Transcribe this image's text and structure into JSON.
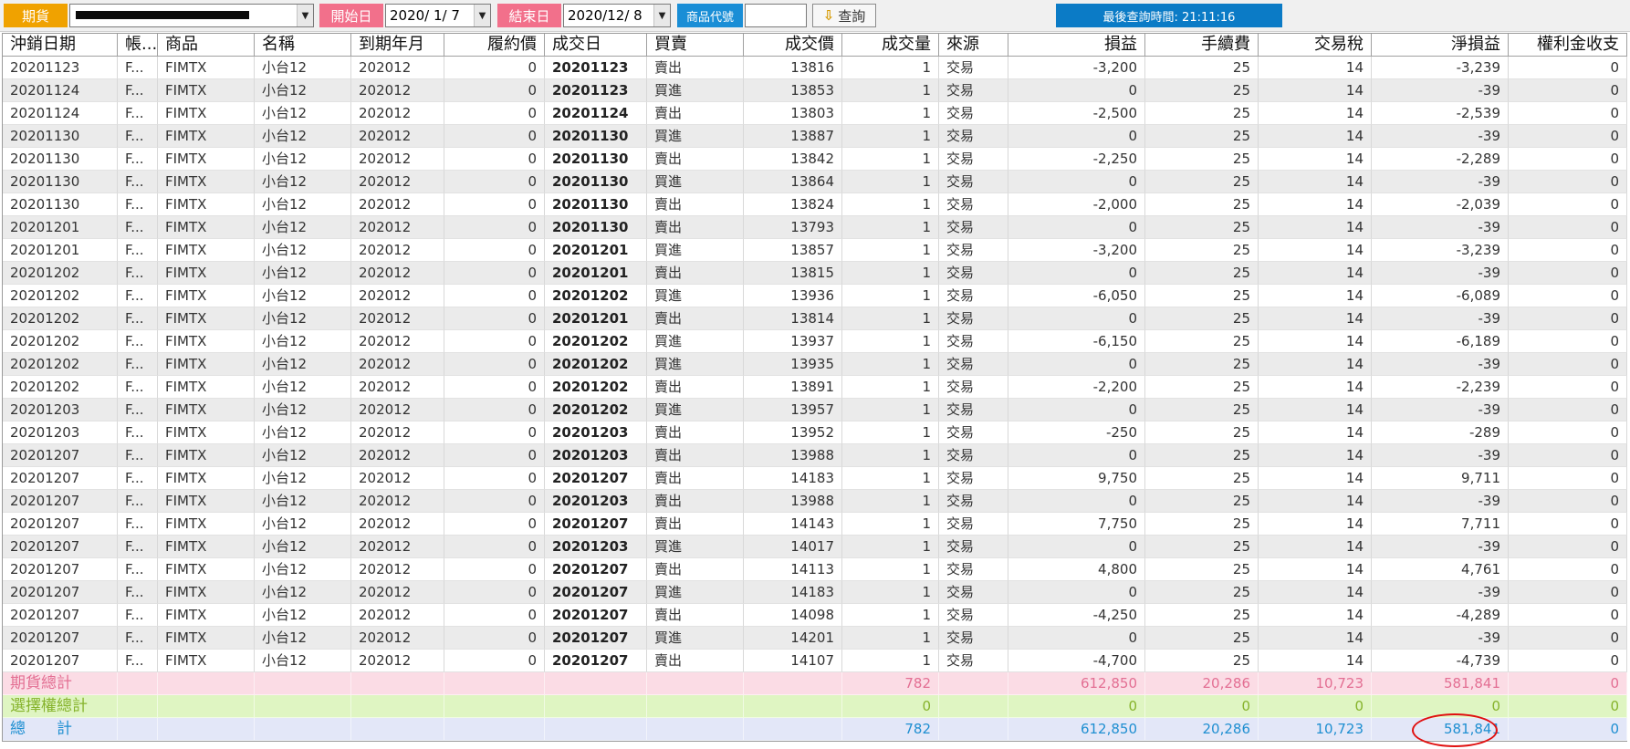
{
  "toolbar": {
    "futures_label": "期貨",
    "account_masked": "",
    "start_label": "開始日",
    "start_date": "2020/ 1/ 7",
    "end_label": "結束日",
    "end_date": "2020/12/ 8",
    "product_code_label": "商品代號",
    "product_code_value": "",
    "query_label": "查詢",
    "last_query_text": "最後查詢時間: 21:11:16"
  },
  "colors": {
    "label_orange": "#f0a200",
    "label_pink": "#f2708b",
    "label_blue": "#1a8ed6",
    "sum_futures_bg": "#fbdce5",
    "sum_options_bg": "#dff5c2",
    "sum_total_bg": "#e3e7f8",
    "highlight": "#e01010"
  },
  "icons": {
    "dropdown": "chevron-down-icon",
    "query": "down-arrow-icon"
  },
  "table": {
    "headers": [
      "沖銷日期",
      "帳...",
      "商品",
      "名稱",
      "到期年月",
      "履約價",
      "成交日",
      "買賣",
      "成交價",
      "成交量",
      "來源",
      "損益",
      "手續費",
      "交易稅",
      "淨損益",
      "權利金收支"
    ],
    "rows": [
      [
        "20201123",
        "F...",
        "FIMTX",
        "小台12",
        "202012",
        "0",
        "20201123",
        "賣出",
        "13816",
        "1",
        "交易",
        "-3,200",
        "25",
        "14",
        "-3,239",
        "0"
      ],
      [
        "20201124",
        "F...",
        "FIMTX",
        "小台12",
        "202012",
        "0",
        "20201123",
        "買進",
        "13853",
        "1",
        "交易",
        "0",
        "25",
        "14",
        "-39",
        "0"
      ],
      [
        "20201124",
        "F...",
        "FIMTX",
        "小台12",
        "202012",
        "0",
        "20201124",
        "賣出",
        "13803",
        "1",
        "交易",
        "-2,500",
        "25",
        "14",
        "-2,539",
        "0"
      ],
      [
        "20201130",
        "F...",
        "FIMTX",
        "小台12",
        "202012",
        "0",
        "20201130",
        "買進",
        "13887",
        "1",
        "交易",
        "0",
        "25",
        "14",
        "-39",
        "0"
      ],
      [
        "20201130",
        "F...",
        "FIMTX",
        "小台12",
        "202012",
        "0",
        "20201130",
        "賣出",
        "13842",
        "1",
        "交易",
        "-2,250",
        "25",
        "14",
        "-2,289",
        "0"
      ],
      [
        "20201130",
        "F...",
        "FIMTX",
        "小台12",
        "202012",
        "0",
        "20201130",
        "買進",
        "13864",
        "1",
        "交易",
        "0",
        "25",
        "14",
        "-39",
        "0"
      ],
      [
        "20201130",
        "F...",
        "FIMTX",
        "小台12",
        "202012",
        "0",
        "20201130",
        "賣出",
        "13824",
        "1",
        "交易",
        "-2,000",
        "25",
        "14",
        "-2,039",
        "0"
      ],
      [
        "20201201",
        "F...",
        "FIMTX",
        "小台12",
        "202012",
        "0",
        "20201130",
        "賣出",
        "13793",
        "1",
        "交易",
        "0",
        "25",
        "14",
        "-39",
        "0"
      ],
      [
        "20201201",
        "F...",
        "FIMTX",
        "小台12",
        "202012",
        "0",
        "20201201",
        "買進",
        "13857",
        "1",
        "交易",
        "-3,200",
        "25",
        "14",
        "-3,239",
        "0"
      ],
      [
        "20201202",
        "F...",
        "FIMTX",
        "小台12",
        "202012",
        "0",
        "20201201",
        "賣出",
        "13815",
        "1",
        "交易",
        "0",
        "25",
        "14",
        "-39",
        "0"
      ],
      [
        "20201202",
        "F...",
        "FIMTX",
        "小台12",
        "202012",
        "0",
        "20201202",
        "買進",
        "13936",
        "1",
        "交易",
        "-6,050",
        "25",
        "14",
        "-6,089",
        "0"
      ],
      [
        "20201202",
        "F...",
        "FIMTX",
        "小台12",
        "202012",
        "0",
        "20201201",
        "賣出",
        "13814",
        "1",
        "交易",
        "0",
        "25",
        "14",
        "-39",
        "0"
      ],
      [
        "20201202",
        "F...",
        "FIMTX",
        "小台12",
        "202012",
        "0",
        "20201202",
        "買進",
        "13937",
        "1",
        "交易",
        "-6,150",
        "25",
        "14",
        "-6,189",
        "0"
      ],
      [
        "20201202",
        "F...",
        "FIMTX",
        "小台12",
        "202012",
        "0",
        "20201202",
        "買進",
        "13935",
        "1",
        "交易",
        "0",
        "25",
        "14",
        "-39",
        "0"
      ],
      [
        "20201202",
        "F...",
        "FIMTX",
        "小台12",
        "202012",
        "0",
        "20201202",
        "賣出",
        "13891",
        "1",
        "交易",
        "-2,200",
        "25",
        "14",
        "-2,239",
        "0"
      ],
      [
        "20201203",
        "F...",
        "FIMTX",
        "小台12",
        "202012",
        "0",
        "20201202",
        "買進",
        "13957",
        "1",
        "交易",
        "0",
        "25",
        "14",
        "-39",
        "0"
      ],
      [
        "20201203",
        "F...",
        "FIMTX",
        "小台12",
        "202012",
        "0",
        "20201203",
        "賣出",
        "13952",
        "1",
        "交易",
        "-250",
        "25",
        "14",
        "-289",
        "0"
      ],
      [
        "20201207",
        "F...",
        "FIMTX",
        "小台12",
        "202012",
        "0",
        "20201203",
        "賣出",
        "13988",
        "1",
        "交易",
        "0",
        "25",
        "14",
        "-39",
        "0"
      ],
      [
        "20201207",
        "F...",
        "FIMTX",
        "小台12",
        "202012",
        "0",
        "20201207",
        "賣出",
        "14183",
        "1",
        "交易",
        "9,750",
        "25",
        "14",
        "9,711",
        "0"
      ],
      [
        "20201207",
        "F...",
        "FIMTX",
        "小台12",
        "202012",
        "0",
        "20201203",
        "賣出",
        "13988",
        "1",
        "交易",
        "0",
        "25",
        "14",
        "-39",
        "0"
      ],
      [
        "20201207",
        "F...",
        "FIMTX",
        "小台12",
        "202012",
        "0",
        "20201207",
        "賣出",
        "14143",
        "1",
        "交易",
        "7,750",
        "25",
        "14",
        "7,711",
        "0"
      ],
      [
        "20201207",
        "F...",
        "FIMTX",
        "小台12",
        "202012",
        "0",
        "20201203",
        "買進",
        "14017",
        "1",
        "交易",
        "0",
        "25",
        "14",
        "-39",
        "0"
      ],
      [
        "20201207",
        "F...",
        "FIMTX",
        "小台12",
        "202012",
        "0",
        "20201207",
        "賣出",
        "14113",
        "1",
        "交易",
        "4,800",
        "25",
        "14",
        "4,761",
        "0"
      ],
      [
        "20201207",
        "F...",
        "FIMTX",
        "小台12",
        "202012",
        "0",
        "20201207",
        "買進",
        "14183",
        "1",
        "交易",
        "0",
        "25",
        "14",
        "-39",
        "0"
      ],
      [
        "20201207",
        "F...",
        "FIMTX",
        "小台12",
        "202012",
        "0",
        "20201207",
        "賣出",
        "14098",
        "1",
        "交易",
        "-4,250",
        "25",
        "14",
        "-4,289",
        "0"
      ],
      [
        "20201207",
        "F...",
        "FIMTX",
        "小台12",
        "202012",
        "0",
        "20201207",
        "買進",
        "14201",
        "1",
        "交易",
        "0",
        "25",
        "14",
        "-39",
        "0"
      ],
      [
        "20201207",
        "F...",
        "FIMTX",
        "小台12",
        "202012",
        "0",
        "20201207",
        "賣出",
        "14107",
        "1",
        "交易",
        "-4,700",
        "25",
        "14",
        "-4,739",
        "0"
      ]
    ],
    "summary": [
      {
        "label": "期貨總計",
        "volume": "782",
        "pnl": "612,850",
        "fee": "20,286",
        "tax": "10,723",
        "net": "581,841",
        "premium": "0"
      },
      {
        "label": "選擇權總計",
        "volume": "0",
        "pnl": "0",
        "fee": "0",
        "tax": "0",
        "net": "0",
        "premium": "0"
      },
      {
        "label": "總　　計",
        "volume": "782",
        "pnl": "612,850",
        "fee": "20,286",
        "tax": "10,723",
        "net": "581,841",
        "premium": "0"
      }
    ]
  }
}
